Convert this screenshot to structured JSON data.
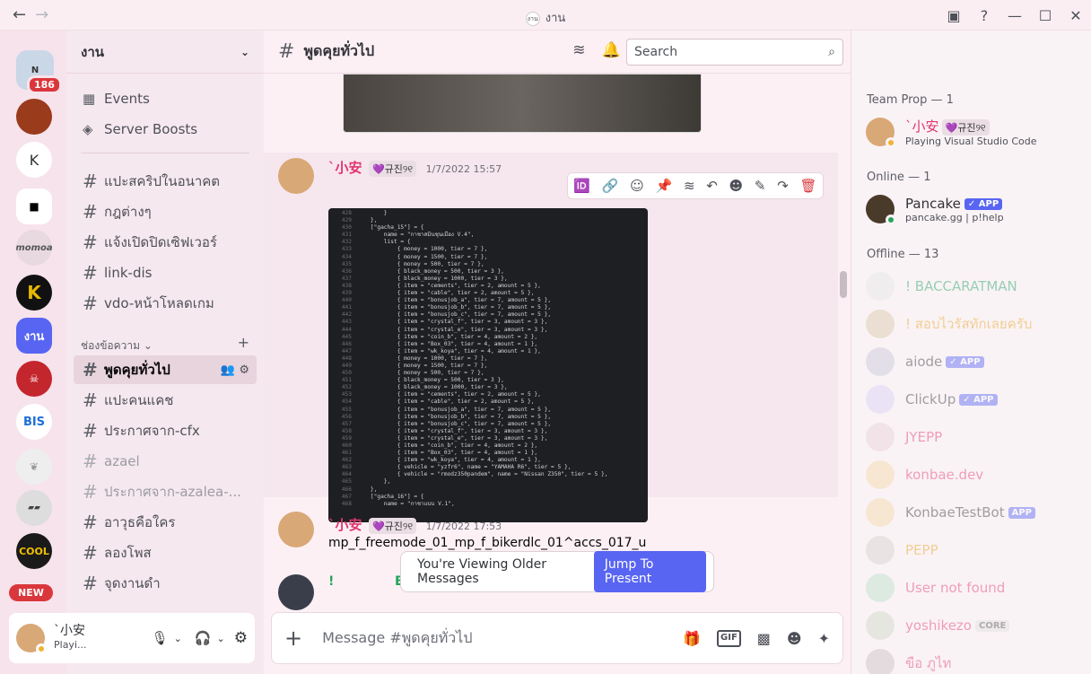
{
  "window": {
    "title": "งาน",
    "server_icon_text": "งาน"
  },
  "guilds": {
    "badge": "186",
    "k": "K",
    "momo": "momoa",
    "active": "งาน",
    "bis": "BIS",
    "cool": "COOL",
    "new": "NEW"
  },
  "server": {
    "name": "งาน",
    "events": "Events",
    "boosts": "Server Boosts",
    "category": "ช่องข้อความ",
    "channels": [
      {
        "name": "แปะสคริปในอนาคต"
      },
      {
        "name": "กฎต่างๆ"
      },
      {
        "name": "แจ้งเปิดปิดเซิฟเวอร์"
      },
      {
        "name": "link-dis"
      },
      {
        "name": "vdo-หน้าโหลดเกม"
      },
      {
        "name": "พูดคุยทั่วไป"
      },
      {
        "name": "แปะคนแคช"
      },
      {
        "name": "ประกาศจาก-cfx"
      },
      {
        "name": "azael"
      },
      {
        "name": "ประกาศจาก-azalea-..."
      },
      {
        "name": "อาวุธคือใคร"
      },
      {
        "name": "ลองโพส"
      },
      {
        "name": "จุดงานดำ"
      }
    ]
  },
  "user": {
    "name": "`小安",
    "status": "Playi..."
  },
  "channel": {
    "name": "พูดคุยทั่วไป",
    "search_placeholder": "Search",
    "composer_placeholder": "Message #พูดคุยทั่วไป"
  },
  "messages": [
    {
      "author": "`小安",
      "tag": "💜규진୨୧",
      "time": "1/7/2022 15:57"
    },
    {
      "author": "`小安",
      "tag": "💜규진୨୧",
      "time": "1/7/2022 17:53",
      "text": "mp_f_freemode_01_mp_f_bikerdlc_01^accs_017_u"
    },
    {
      "author": "!",
      "text": "E"
    }
  ],
  "code_lines": [
    {
      "n": "428",
      "t": "        }"
    },
    {
      "n": "429",
      "t": "    },"
    },
    {
      "n": "430",
      "t": "    [\"gacha_15\"] = {"
    },
    {
      "n": "431",
      "t": "        name = \"กาชาสมินชุนเมือง V.4\","
    },
    {
      "n": "432",
      "t": "        list = {"
    },
    {
      "n": "433",
      "t": "            { money = 1000, tier = 7 },"
    },
    {
      "n": "434",
      "t": "            { money = 1500, tier = 7 },"
    },
    {
      "n": "435",
      "t": "            { money = 500, tier = 7 },"
    },
    {
      "n": "436",
      "t": "            { black_money = 500, tier = 3 },"
    },
    {
      "n": "437",
      "t": "            { black_money = 1000, tier = 3 },"
    },
    {
      "n": "438",
      "t": "            { item = \"cements\", tier = 2, amount = 5 },"
    },
    {
      "n": "439",
      "t": "            { item = \"cable\", tier = 2, amount = 5 },"
    },
    {
      "n": "440",
      "t": "            { item = \"bonusjob_a\", tier = 7, amount = 5 },"
    },
    {
      "n": "441",
      "t": "            { item = \"bonusjob_b\", tier = 7, amount = 5 },"
    },
    {
      "n": "442",
      "t": "            { item = \"bonusjob_c\", tier = 7, amount = 5 },"
    },
    {
      "n": "443",
      "t": "            { item = \"crystal_f\", tier = 3, amount = 3 },"
    },
    {
      "n": "444",
      "t": "            { item = \"crystal_e\", tier = 3, amount = 3 },"
    },
    {
      "n": "445",
      "t": "            { item = \"coin_b\", tier = 4, amount = 2 },"
    },
    {
      "n": "446",
      "t": "            { item = \"Box_03\", tier = 4, amount = 1 },"
    },
    {
      "n": "447",
      "t": "            { item = \"wk_koya\", tier = 4, amount = 1 },"
    },
    {
      "n": "448",
      "t": "            { money = 1000, tier = 7 },"
    },
    {
      "n": "449",
      "t": "            { money = 1500, tier = 7 },"
    },
    {
      "n": "450",
      "t": "            { money = 500, tier = 7 },"
    },
    {
      "n": "451",
      "t": "            { black_money = 500, tier = 3 },"
    },
    {
      "n": "452",
      "t": "            { black_money = 1000, tier = 3 },"
    },
    {
      "n": "453",
      "t": "            { item = \"cements\", tier = 2, amount = 5 },"
    },
    {
      "n": "454",
      "t": "            { item = \"cable\", tier = 2, amount = 5 },"
    },
    {
      "n": "455",
      "t": "            { item = \"bonusjob_a\", tier = 7, amount = 5 },"
    },
    {
      "n": "456",
      "t": "            { item = \"bonusjob_b\", tier = 7, amount = 5 },"
    },
    {
      "n": "457",
      "t": "            { item = \"bonusjob_c\", tier = 7, amount = 5 },"
    },
    {
      "n": "458",
      "t": "            { item = \"crystal_f\", tier = 3, amount = 3 },"
    },
    {
      "n": "459",
      "t": "            { item = \"crystal_e\", tier = 3, amount = 3 },"
    },
    {
      "n": "460",
      "t": "            { item = \"coin_b\", tier = 4, amount = 2 },"
    },
    {
      "n": "461",
      "t": "            { item = \"Box_03\", tier = 4, amount = 1 },"
    },
    {
      "n": "462",
      "t": "            { item = \"wk_koya\", tier = 4, amount = 1 },"
    },
    {
      "n": "463",
      "t": "            { vehicle = \"yzfr6\", name = \"YAMAHA R6\", tier = 5 },"
    },
    {
      "n": "464",
      "t": "            { vehicle = \"rmodz350pandem\", name = \"Nissan Z350\", tier = 5 },"
    },
    {
      "n": "465",
      "t": "        },"
    },
    {
      "n": "466",
      "t": "    },"
    },
    {
      "n": "467",
      "t": "    [\"gacha_16\"] = {"
    },
    {
      "n": "468",
      "t": "        name = \"กาชาแบบ V.1\","
    }
  ],
  "toast": {
    "text": "You're Viewing Older Messages",
    "button": "Jump To Present"
  },
  "members": {
    "team_header": "Team Prop — 1",
    "online_header": "Online — 1",
    "offline_header": "Offline — 13",
    "team": [
      {
        "name": "`小安",
        "tag": "💜규진୨୧",
        "activity": "Playing Visual Studio Code",
        "color": "#e0356d"
      }
    ],
    "online": [
      {
        "name": "Pancake",
        "badge": "✓ APP",
        "activity": "pancake.gg | p!help"
      }
    ],
    "offline": [
      {
        "name": "! BACCARATMAN",
        "color": "#1fa361"
      },
      {
        "name": "! สอบไวรัสทักเลยครับ",
        "color": "#e6a21a"
      },
      {
        "name": "aiode",
        "badge": "✓ APP",
        "color": "#313338"
      },
      {
        "name": "ClickUp",
        "badge": "✓ APP",
        "color": "#313338"
      },
      {
        "name": "JYEPP",
        "color": "#e0356d"
      },
      {
        "name": "konbae.dev",
        "color": "#e0356d"
      },
      {
        "name": "KonbaeTestBot",
        "badge": "APP",
        "color": "#313338"
      },
      {
        "name": "PEPP",
        "color": "#e6a21a"
      },
      {
        "name": "User not found",
        "color": "#e0356d"
      },
      {
        "name": "yoshikezo",
        "badge": "CORE",
        "color": "#e0356d"
      },
      {
        "name": "ขือ ภูไท",
        "color": "#e0356d"
      }
    ]
  },
  "colors": {
    "accent": "#5865f2",
    "mention": "#e0356d",
    "online": "#23a55a"
  }
}
